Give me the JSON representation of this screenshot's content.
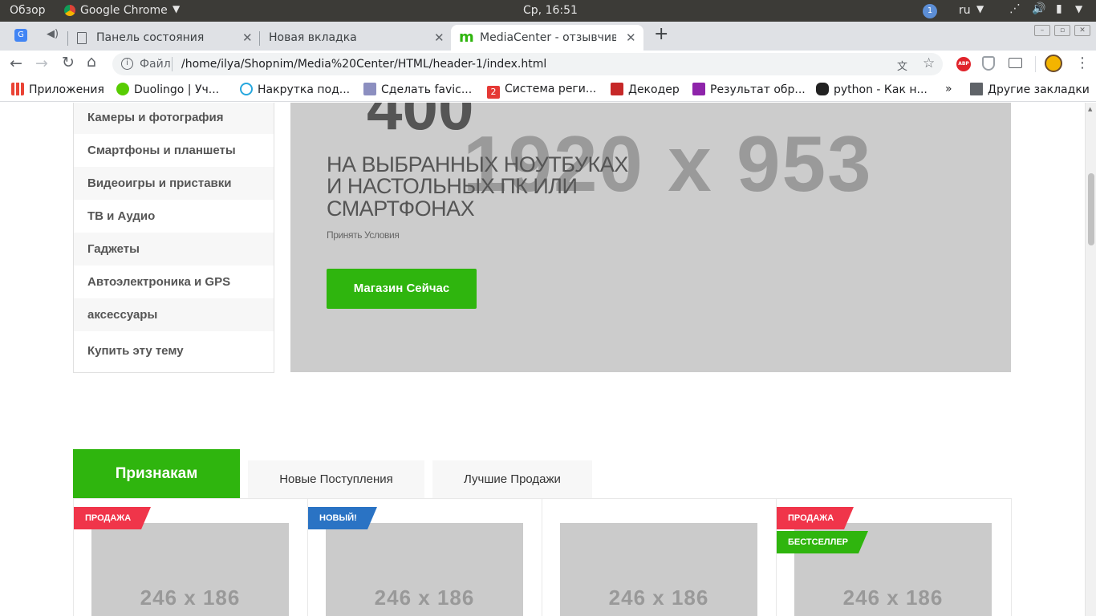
{
  "os": {
    "activities": "Обзор",
    "app": "Google Chrome",
    "clock": "Ср, 16:51",
    "lang": "ru",
    "notif_count": "1"
  },
  "tabs": [
    {
      "title": "Панель состояния"
    },
    {
      "title": "Новая вкладка"
    },
    {
      "title": "MediaCenter - отзывчивый"
    }
  ],
  "address": {
    "scheme_label": "Файл",
    "url": "/home/ilya/Shopnim/Media%20Center/HTML/header-1/index.html"
  },
  "bookmarks": {
    "apps": "Приложения",
    "items": [
      "Duolingo | Уч...",
      "Накрутка под...",
      "Сделать favic...",
      "Система реги...",
      "Декодер",
      "Результат обр...",
      "python - Как н..."
    ],
    "more": "»",
    "other": "Другие закладки"
  },
  "categories": [
    "Камеры и фотография",
    "Смартфоны и планшеты",
    "Видеоигры и приставки",
    "ТВ и Аудио",
    "Гаджеты",
    "Автоэлектроника и GPS",
    "аксессуары",
    "Купить эту тему"
  ],
  "hero": {
    "big_number": "400",
    "placeholder": "1920 x 953",
    "line1": "НА ВЫБРАННЫХ НОУТБУКАХ",
    "line2": "И НАСТОЛЬНЫХ ПК ИЛИ",
    "line3": "СМАРТФОНАХ",
    "terms": "Принять Условия",
    "button": "Магазин Сейчас"
  },
  "product_tabs": [
    "Признакам",
    "Новые Поступления",
    "Лучшие Продажи"
  ],
  "products": [
    {
      "image": "246 x 186",
      "badges": [
        "ПРОДАЖА"
      ]
    },
    {
      "image": "246 x 186",
      "badges": [
        "НОВЫЙ!"
      ]
    },
    {
      "image": "246 x 186",
      "badges": []
    },
    {
      "image": "246 x 186",
      "badges": [
        "ПРОДАЖА",
        "БЕСТСЕЛЛЕР"
      ]
    }
  ],
  "colors": {
    "accent_green": "#2fb50e",
    "sale_red": "#f0354a",
    "new_blue": "#2a73c4",
    "hero_gray": "#cccccc"
  }
}
